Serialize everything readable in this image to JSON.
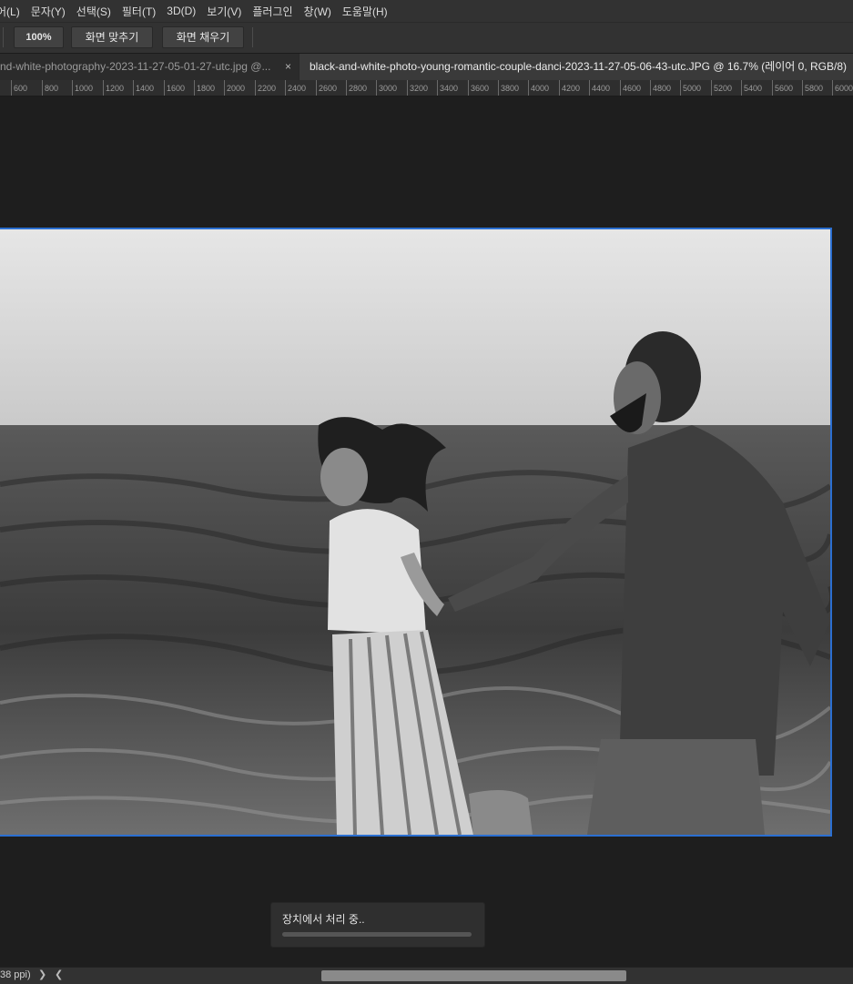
{
  "menu": [
    "어(L)",
    "문자(Y)",
    "선택(S)",
    "필터(T)",
    "3D(D)",
    "보기(V)",
    "플러그인",
    "창(W)",
    "도움말(H)"
  ],
  "options": {
    "zoom": "100%",
    "fit_screen": "화면 맞추기",
    "fill_screen": "화면 채우기"
  },
  "tabs": {
    "inactive": "nd-white-photography-2023-11-27-05-01-27-utc.jpg @...",
    "inactive_close": "×",
    "active": "black-and-white-photo-young-romantic-couple-danci-2023-11-27-05-06-43-utc.JPG @ 16.7% (레이어 0, RGB/8)"
  },
  "ruler": [
    "600",
    "800",
    "1000",
    "1200",
    "1400",
    "1600",
    "1800",
    "2000",
    "2200",
    "2400",
    "2600",
    "2800",
    "3000",
    "3200",
    "3400",
    "3600",
    "3800",
    "4000",
    "4200",
    "4400",
    "4600",
    "4800",
    "5000",
    "5200",
    "5400",
    "5600",
    "5800",
    "6000"
  ],
  "progress": {
    "label": "장치에서 처리 중..",
    "fraction": 0.0
  },
  "status": {
    "ppi": "38 ppi)",
    "next": "❯",
    "prev": "❮"
  },
  "colors": {
    "accent": "#2b6fd1",
    "panel": "#323232",
    "canvas_bg": "#1e1e1e"
  }
}
